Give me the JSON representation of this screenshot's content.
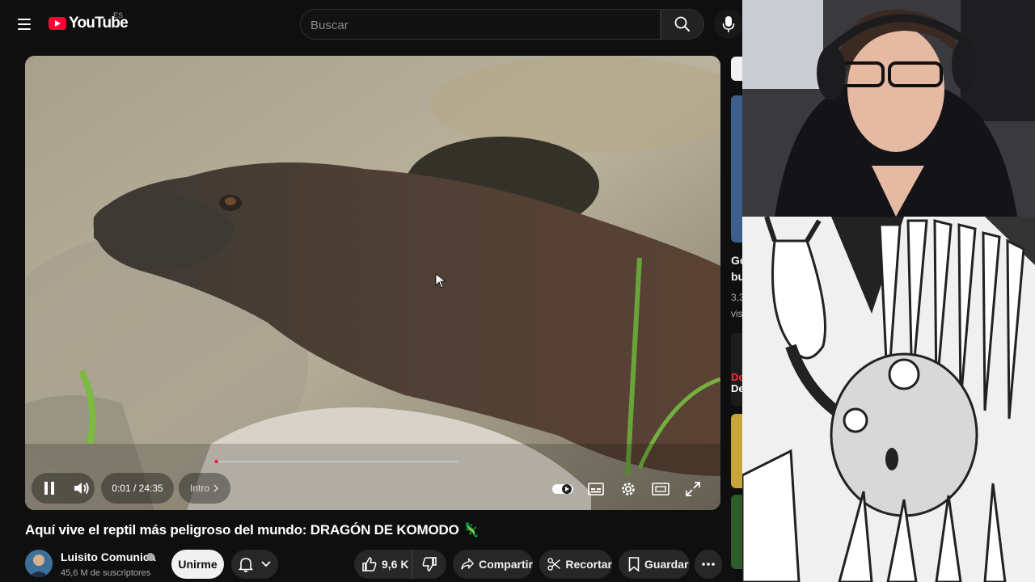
{
  "header": {
    "logo_text": "YouTube",
    "region": "ES",
    "search_placeholder": "Buscar"
  },
  "player": {
    "current_time": "0:01",
    "duration": "24:35",
    "chapter": "Intro",
    "progress_fraction": 0.0007
  },
  "video": {
    "title": "Aquí vive el reptil más peligroso del mundo: DRAGÓN DE KOMODO 🦎",
    "channel": "Luisito Comunica",
    "subscribers": "45,6 M de suscriptores",
    "join_label": "Unirme",
    "likes": "9,6 K",
    "share_label": "Compartir",
    "clip_label": "Recortar",
    "save_label": "Guardar"
  },
  "sidebar": {
    "partial_title_1": "Go",
    "partial_title_2": "bu",
    "partial_meta_1": "3,3",
    "partial_meta_2": "vis",
    "partial_thumb_text_1": "De",
    "partial_thumb_text_2": "De"
  },
  "colors": {
    "accent": "#ff0033",
    "background": "#0f0f0f",
    "pill": "#272727"
  }
}
